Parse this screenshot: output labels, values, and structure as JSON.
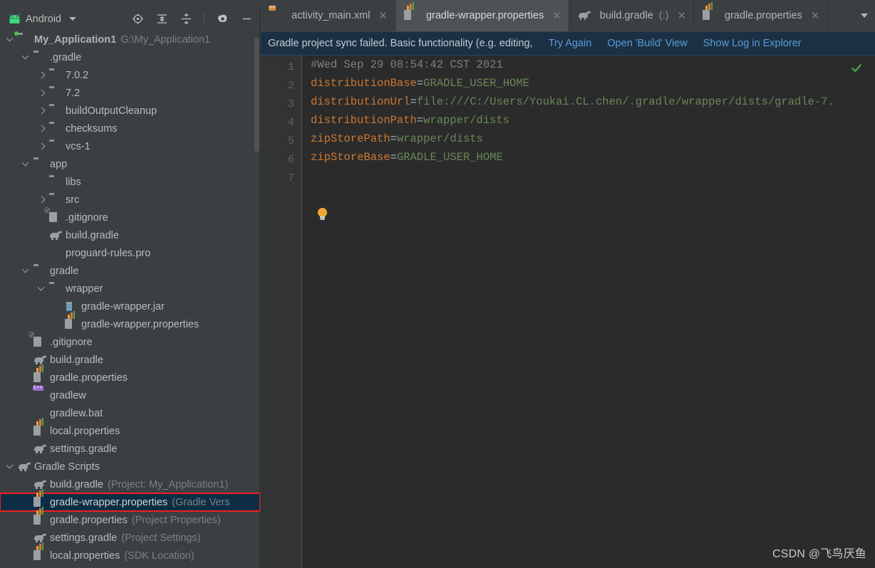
{
  "window": {
    "left_panel_title": "Android",
    "left_panel_icon": "android-logo-icon",
    "dropdown_icon": "chevron-down-icon"
  },
  "panel_toolbar": [
    {
      "name": "locate-target-icon",
      "label": "Select Opened File"
    },
    {
      "name": "expand-all-icon",
      "label": "Expand All"
    },
    {
      "name": "collapse-all-icon",
      "label": "Collapse All"
    },
    {
      "name": "gear-icon",
      "label": "Settings"
    },
    {
      "name": "minimize-icon",
      "label": "Hide"
    }
  ],
  "tree": [
    {
      "indent": 0,
      "arrow": "down",
      "icon": "folder-project-icon",
      "label": "My_Application1",
      "bold": true,
      "sub": "G:\\My_Application1"
    },
    {
      "indent": 1,
      "arrow": "down",
      "icon": "folder-icon",
      "label": ".gradle",
      "sub": ""
    },
    {
      "indent": 2,
      "arrow": "right",
      "icon": "folder-icon",
      "label": "7.0.2",
      "sub": ""
    },
    {
      "indent": 2,
      "arrow": "right",
      "icon": "folder-icon",
      "label": "7.2",
      "sub": ""
    },
    {
      "indent": 2,
      "arrow": "right",
      "icon": "folder-icon",
      "label": "buildOutputCleanup",
      "sub": ""
    },
    {
      "indent": 2,
      "arrow": "right",
      "icon": "folder-icon",
      "label": "checksums",
      "sub": ""
    },
    {
      "indent": 2,
      "arrow": "right",
      "icon": "folder-icon",
      "label": "vcs-1",
      "sub": ""
    },
    {
      "indent": 1,
      "arrow": "down",
      "icon": "folder-icon",
      "label": "app",
      "sub": ""
    },
    {
      "indent": 2,
      "arrow": "none",
      "icon": "folder-icon",
      "label": "libs",
      "sub": ""
    },
    {
      "indent": 2,
      "arrow": "right",
      "icon": "folder-icon",
      "label": "src",
      "sub": ""
    },
    {
      "indent": 2,
      "arrow": "none",
      "icon": "gitignore-icon",
      "label": ".gitignore",
      "sub": ""
    },
    {
      "indent": 2,
      "arrow": "none",
      "icon": "gradle-elephant-icon",
      "label": "build.gradle",
      "sub": ""
    },
    {
      "indent": 2,
      "arrow": "none",
      "icon": "text-file-icon",
      "label": "proguard-rules.pro",
      "sub": ""
    },
    {
      "indent": 1,
      "arrow": "down",
      "icon": "folder-icon",
      "label": "gradle",
      "sub": ""
    },
    {
      "indent": 2,
      "arrow": "down",
      "icon": "folder-icon",
      "label": "wrapper",
      "sub": ""
    },
    {
      "indent": 3,
      "arrow": "none",
      "icon": "jar-file-icon",
      "label": "gradle-wrapper.jar",
      "sub": ""
    },
    {
      "indent": 3,
      "arrow": "none",
      "icon": "properties-file-icon",
      "label": "gradle-wrapper.properties",
      "sub": ""
    },
    {
      "indent": 1,
      "arrow": "none",
      "icon": "gitignore-icon",
      "label": ".gitignore",
      "sub": ""
    },
    {
      "indent": 1,
      "arrow": "none",
      "icon": "gradle-elephant-icon",
      "label": "build.gradle",
      "sub": ""
    },
    {
      "indent": 1,
      "arrow": "none",
      "icon": "properties-file-icon",
      "label": "gradle.properties",
      "sub": ""
    },
    {
      "indent": 1,
      "arrow": "none",
      "icon": "shell-script-icon",
      "label": "gradlew",
      "sub": ""
    },
    {
      "indent": 1,
      "arrow": "none",
      "icon": "text-file-icon",
      "label": "gradlew.bat",
      "sub": ""
    },
    {
      "indent": 1,
      "arrow": "none",
      "icon": "properties-file-icon",
      "label": "local.properties",
      "sub": ""
    },
    {
      "indent": 1,
      "arrow": "none",
      "icon": "gradle-elephant-icon",
      "label": "settings.gradle",
      "sub": ""
    },
    {
      "indent": 0,
      "arrow": "down",
      "icon": "gradle-elephant-icon",
      "label": "Gradle Scripts",
      "sub": ""
    },
    {
      "indent": 1,
      "arrow": "none",
      "icon": "gradle-elephant-icon",
      "label": "build.gradle",
      "sub": "(Project: My_Application1)"
    },
    {
      "indent": 1,
      "arrow": "none",
      "icon": "properties-file-icon",
      "label": "gradle-wrapper.properties",
      "sub": "(Gradle Vers",
      "selected": true,
      "annotated": true
    },
    {
      "indent": 1,
      "arrow": "none",
      "icon": "properties-file-icon",
      "label": "gradle.properties",
      "sub": "(Project Properties)"
    },
    {
      "indent": 1,
      "arrow": "none",
      "icon": "gradle-elephant-icon",
      "label": "settings.gradle",
      "sub": "(Project Settings)"
    },
    {
      "indent": 1,
      "arrow": "none",
      "icon": "properties-file-icon",
      "label": "local.properties",
      "sub": "(SDK Location)"
    }
  ],
  "editor_tabs": [
    {
      "label": "activity_main.xml",
      "icon": "xml-layout-file-icon",
      "suffix": "",
      "active": false,
      "close_icon": "close-icon"
    },
    {
      "label": "gradle-wrapper.properties",
      "icon": "properties-file-icon",
      "suffix": "",
      "active": true,
      "close_icon": "close-icon"
    },
    {
      "label": "build.gradle",
      "icon": "gradle-elephant-icon",
      "suffix": "(:)",
      "active": false,
      "close_icon": "close-icon"
    },
    {
      "label": "gradle.properties",
      "icon": "properties-file-icon",
      "suffix": "",
      "active": false,
      "close_icon": "close-icon"
    }
  ],
  "tabs_overflow": {
    "file_icon": "text-file-icon",
    "chevron_icon": "chevron-down-icon"
  },
  "notification": {
    "message": "Gradle project sync failed. Basic functionality (e.g. editing,",
    "links": [
      "Try Again",
      "Open 'Build' View",
      "Show Log in Explorer"
    ]
  },
  "editor": {
    "line_numbers": [
      "1",
      "2",
      "3",
      "4",
      "5",
      "6",
      "7"
    ],
    "lines": [
      {
        "type": "comment",
        "text": "#Wed Sep 29 08:54:42 CST 2021"
      },
      {
        "type": "kv",
        "key": "distributionBase",
        "value": "GRADLE_USER_HOME"
      },
      {
        "type": "kv",
        "key": "distributionUrl",
        "value": "file:///C:/Users/Youkai.CL.chen/.gradle/wrapper/dists/gradle-7."
      },
      {
        "type": "kv",
        "key": "distributionPath",
        "value": "wrapper/dists"
      },
      {
        "type": "kv",
        "key": "zipStorePath",
        "value": "wrapper/dists"
      },
      {
        "type": "kv",
        "key": "zipStoreBase",
        "value": "GRADLE_USER_HOME"
      },
      {
        "type": "blank",
        "text": ""
      }
    ],
    "intention_bulb_icon": "lightbulb-icon",
    "inspection_status_icon": "checkmark-icon",
    "inspection_status_color": "#4a9e4a"
  },
  "watermark": "CSDN @飞鸟厌鱼",
  "colors": {
    "panel_bg": "#3c3f41",
    "editor_bg": "#2b2b2b",
    "gutter_bg": "#313335",
    "notification_bg": "#1b3043",
    "selection_bg": "#0d2d44",
    "annotation_border": "#ef1f1f",
    "key_color": "#cc7832",
    "value_color": "#6a8759",
    "comment_color": "#808080",
    "link_color": "#5b9bd8"
  }
}
